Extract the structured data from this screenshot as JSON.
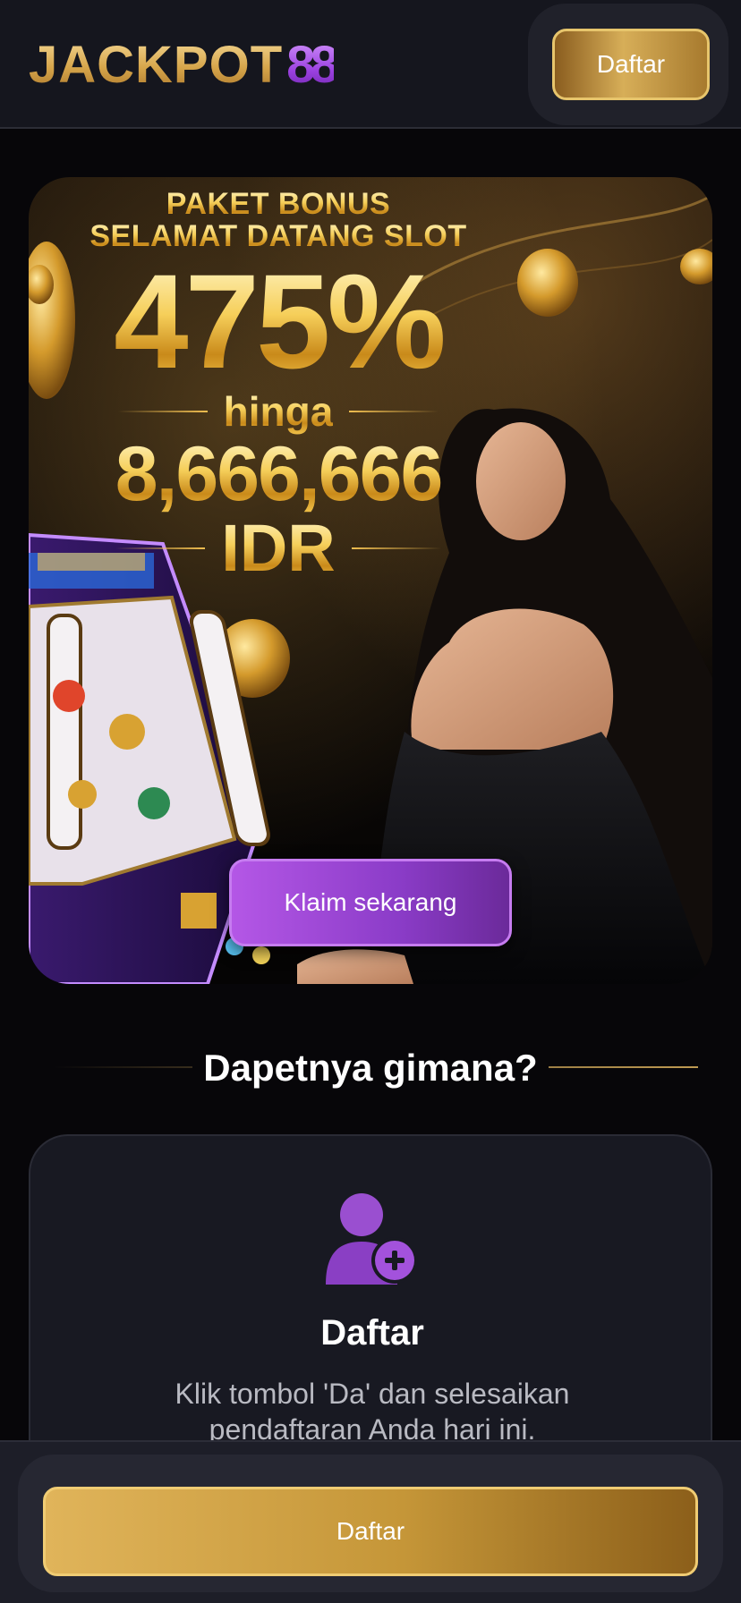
{
  "header": {
    "logo_word": "JACKPOT",
    "logo_number": "88",
    "register_button": "Daftar"
  },
  "banner": {
    "line1": "PAKET BONUS",
    "line2": "SELAMAT DATANG SLOT",
    "percent": "475%",
    "connector": "hinga",
    "amount": "8,666,666",
    "currency": "IDR",
    "claim_button": "Klaim sekarang"
  },
  "section": {
    "title": "Dapetnya gimana?"
  },
  "step": {
    "icon": "user-plus-icon",
    "title": "Daftar",
    "description": "Klik tombol 'Da' dan selesaikan pendaftaran Anda hari ini."
  },
  "bottom_bar": {
    "register_button": "Daftar"
  },
  "colors": {
    "gold": "#d7ae58",
    "purple": "#9b41e0",
    "background": "#070609",
    "card": "#181922"
  }
}
